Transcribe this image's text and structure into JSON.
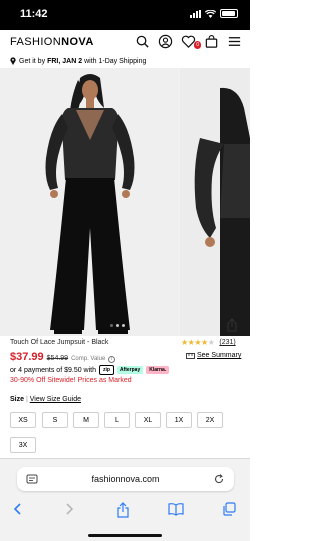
{
  "status_bar": {
    "time": "11:42"
  },
  "header": {
    "logo_part1": "FASHION",
    "logo_part2": "NOVA",
    "wishlist_count": "0"
  },
  "shipping": {
    "prefix": "Get it by",
    "date": "FRI, JAN 2",
    "suffix": "with 1-Day Shipping"
  },
  "gallery": {
    "dot_count": 3,
    "active_index": 0
  },
  "product": {
    "name": "Touch Of Lace Jumpsuit - Black",
    "rating": 4,
    "review_count": "(231)",
    "price": "$37.99",
    "compare_price": "$54.99",
    "compare_label": "Comp. Value",
    "size_summary_link": "See Summary",
    "payments_text": "or 4 payments of $9.50 with",
    "pay_badges": [
      "zip",
      "Afterpay",
      "Klarna."
    ],
    "sale_text": "30-90% Off Sitewide! Prices as Marked"
  },
  "size": {
    "label": "Size",
    "guide_link": "View Size Guide",
    "options": [
      "XS",
      "S",
      "M",
      "L",
      "XL",
      "1X",
      "2X",
      "3X"
    ]
  },
  "browser": {
    "url": "fashionnova.com"
  },
  "colors": {
    "accent_red": "#d6212b",
    "star": "#f0b72f"
  }
}
